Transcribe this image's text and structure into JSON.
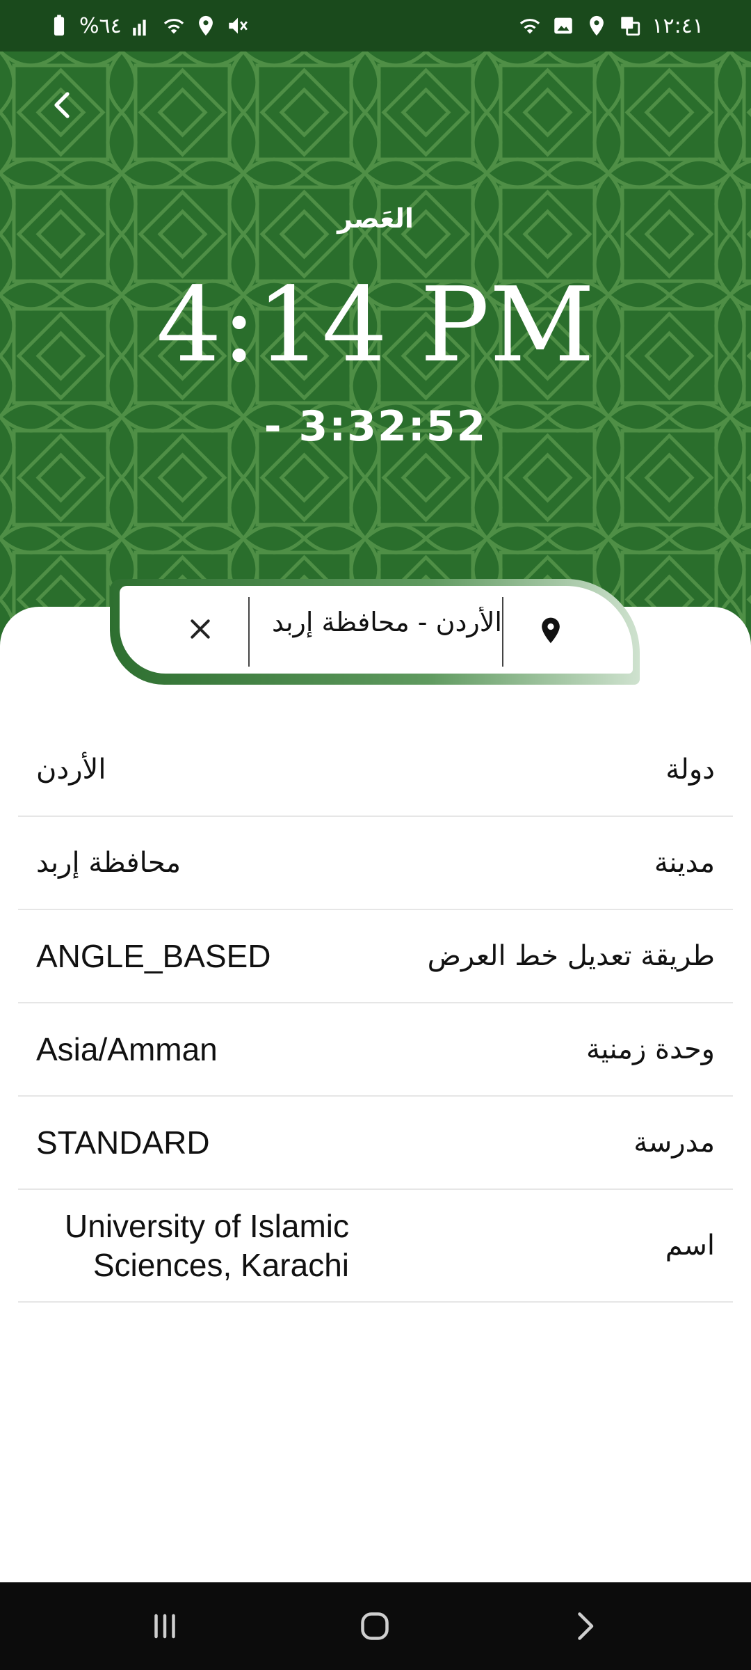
{
  "status_bar": {
    "time": "١٢:٤١",
    "battery": "%٦٤"
  },
  "header": {
    "prayer_name": "العَصر",
    "prayer_time": "4:14 PM",
    "countdown": "-  3:32:52"
  },
  "location": {
    "text": "الأردن - محافظة إربد"
  },
  "rows": [
    {
      "label": "دولة",
      "value": "الأردن"
    },
    {
      "label": "مدينة",
      "value": "محافظة إربد"
    },
    {
      "label": "طريقة تعديل خط العرض",
      "value": "ANGLE_BASED"
    },
    {
      "label": "وحدة زمنية",
      "value": "Asia/Amman"
    },
    {
      "label": "مدرسة",
      "value": "STANDARD"
    },
    {
      "label": "اسم",
      "value_line1": "University of Islamic",
      "value_line2": "Sciences, Karachi"
    }
  ],
  "colors": {
    "header_green": "#2a6e2c",
    "status_green": "#1a4a1c",
    "nav_black": "#0c0c0c"
  }
}
